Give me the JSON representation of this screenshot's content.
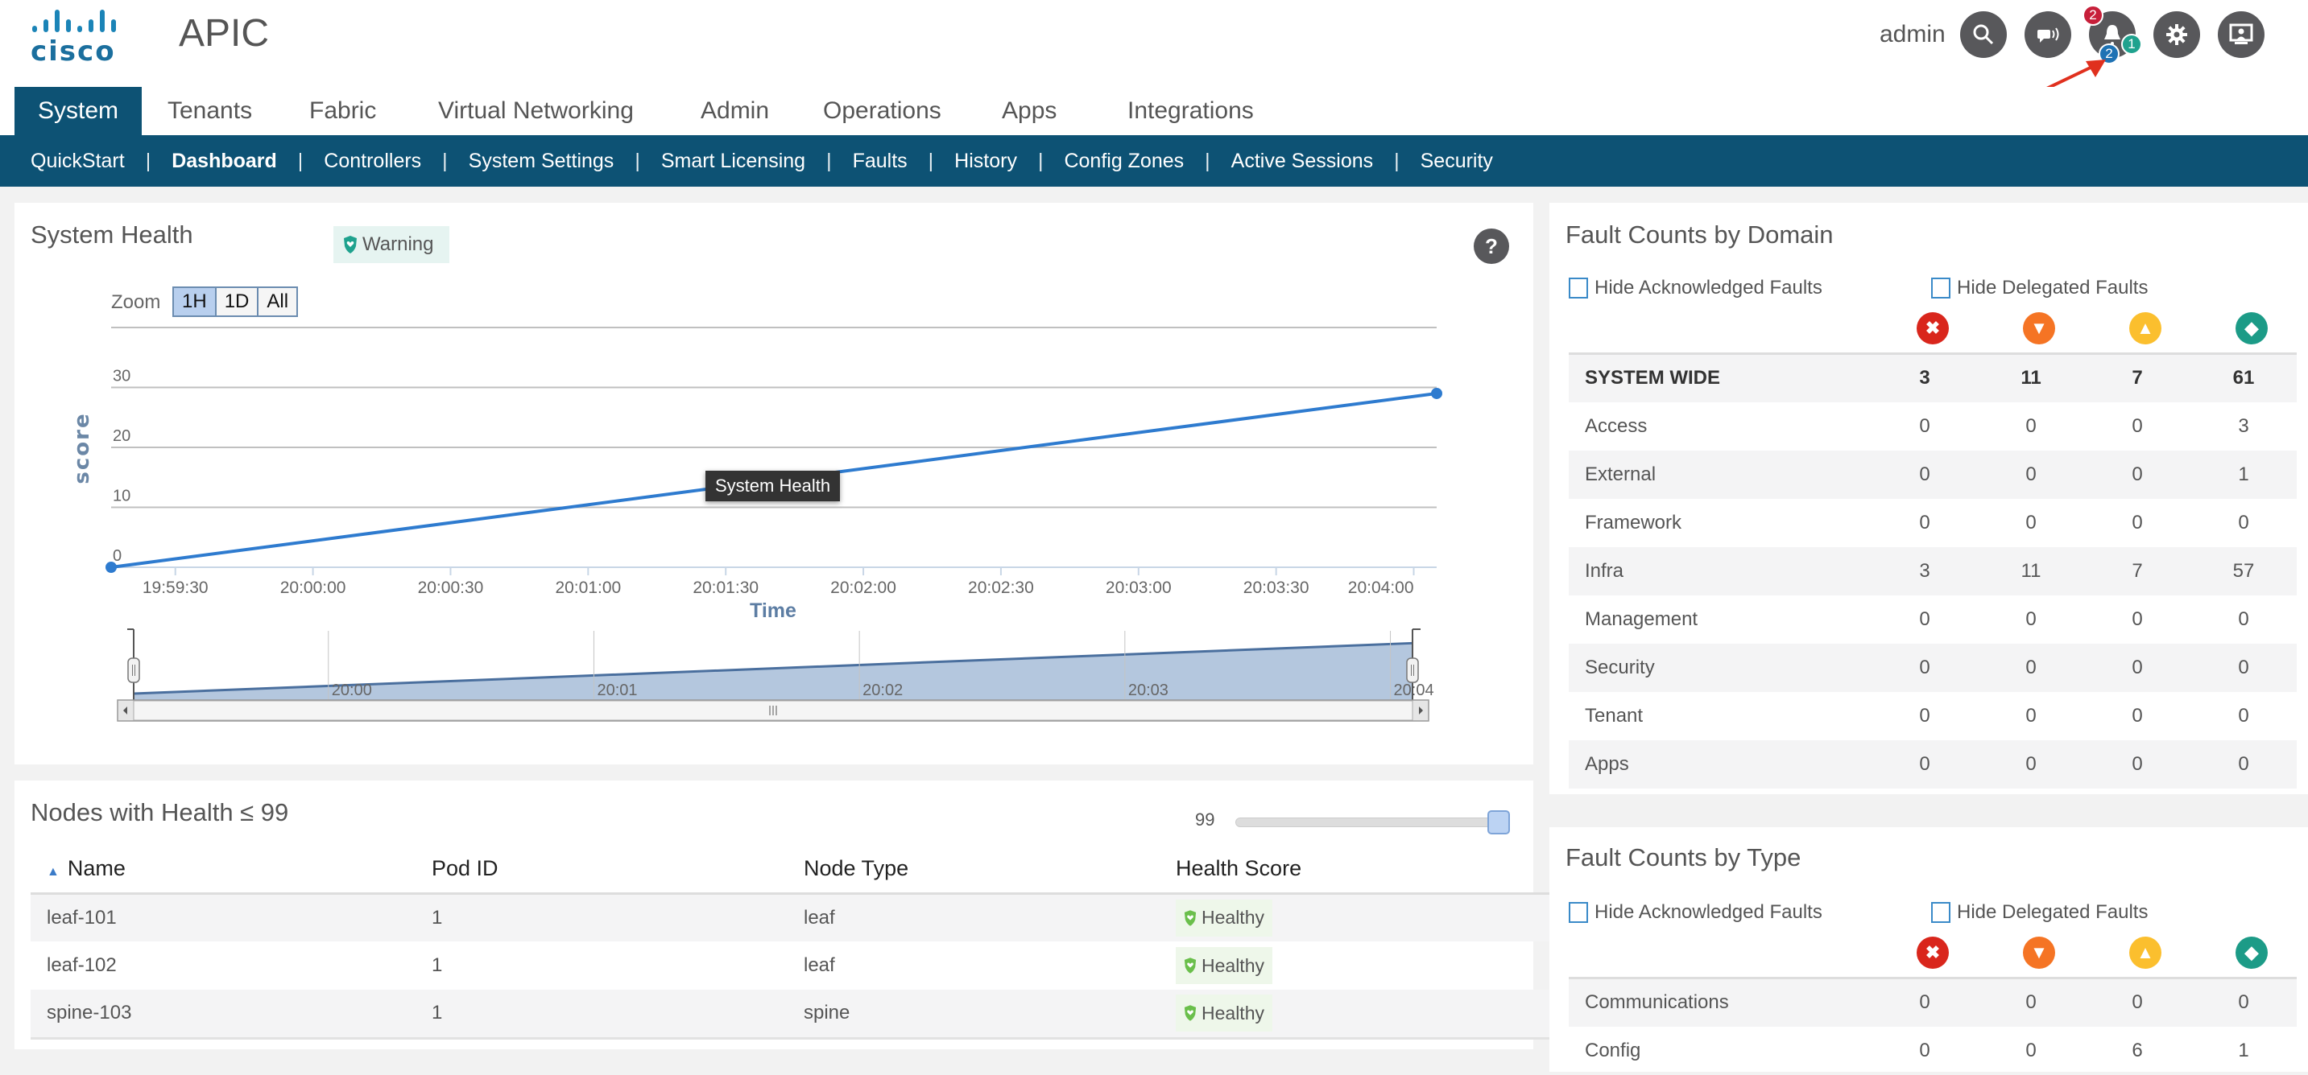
{
  "header": {
    "logo_text": "cisco",
    "app_title": "APIC",
    "user": "admin",
    "buttons": [
      {
        "name": "search-button",
        "icon": "search-icon"
      },
      {
        "name": "announcements-button",
        "icon": "megaphone-icon"
      },
      {
        "name": "alerts-button",
        "icon": "bell-icon",
        "badges": {
          "red": "2",
          "blue": "2",
          "teal": "1"
        }
      },
      {
        "name": "settings-button",
        "icon": "gear-icon"
      },
      {
        "name": "system-tools-button",
        "icon": "monitor-user-icon"
      }
    ]
  },
  "main_nav": {
    "tabs": [
      "System",
      "Tenants",
      "Fabric",
      "Virtual Networking",
      "Admin",
      "Operations",
      "Apps",
      "Integrations"
    ],
    "active": "System"
  },
  "sub_nav": {
    "items": [
      "QuickStart",
      "Dashboard",
      "Controllers",
      "System Settings",
      "Smart Licensing",
      "Faults",
      "History",
      "Config Zones",
      "Active Sessions",
      "Security"
    ],
    "active": "Dashboard"
  },
  "system_health": {
    "title": "System Health",
    "status": "Warning",
    "help": "?",
    "zoom_label": "Zoom",
    "zoom_options": [
      "1H",
      "1D",
      "All"
    ],
    "zoom_active": "1H",
    "tooltip": "System Health"
  },
  "chart_data": {
    "type": "line",
    "title": "System Health",
    "xlabel": "Time",
    "ylabel": "score",
    "x_ticks": [
      "19:59:30",
      "20:00:00",
      "20:00:30",
      "20:01:00",
      "20:01:30",
      "20:02:00",
      "20:02:30",
      "20:03:00",
      "20:03:30",
      "20:04:00"
    ],
    "y_ticks": [
      0,
      10,
      20,
      30
    ],
    "ylim": [
      0,
      40
    ],
    "grid": true,
    "series": [
      {
        "name": "System Health",
        "x": [
          "19:59:16",
          "20:04:05"
        ],
        "y": [
          0,
          29
        ],
        "color": "#2e7bcf"
      }
    ],
    "navigator": {
      "ticks": [
        "20:00",
        "20:01",
        "20:02",
        "20:03",
        "20:04"
      ]
    }
  },
  "nodes": {
    "title": "Nodes with Health ≤ 99",
    "slider_value": "99",
    "slider_fraction": 1.0,
    "columns": [
      "Name",
      "Pod ID",
      "Node Type",
      "Health Score"
    ],
    "rows": [
      {
        "name": "leaf-101",
        "pod": "1",
        "type": "leaf",
        "health": "Healthy"
      },
      {
        "name": "leaf-102",
        "pod": "1",
        "type": "leaf",
        "health": "Healthy"
      },
      {
        "name": "spine-103",
        "pod": "1",
        "type": "spine",
        "health": "Healthy"
      }
    ]
  },
  "fault_domain": {
    "title": "Fault Counts by Domain",
    "hide_ack": "Hide Acknowledged Faults",
    "hide_delegated": "Hide Delegated Faults",
    "severity_icons": [
      "critical-icon",
      "major-icon",
      "minor-icon",
      "warning-icon"
    ],
    "rows": [
      {
        "label": "SYSTEM WIDE",
        "values": [
          "3",
          "11",
          "7",
          "61"
        ],
        "bold": true
      },
      {
        "label": "Access",
        "values": [
          "0",
          "0",
          "0",
          "3"
        ]
      },
      {
        "label": "External",
        "values": [
          "0",
          "0",
          "0",
          "1"
        ]
      },
      {
        "label": "Framework",
        "values": [
          "0",
          "0",
          "0",
          "0"
        ]
      },
      {
        "label": "Infra",
        "values": [
          "3",
          "11",
          "7",
          "57"
        ]
      },
      {
        "label": "Management",
        "values": [
          "0",
          "0",
          "0",
          "0"
        ]
      },
      {
        "label": "Security",
        "values": [
          "0",
          "0",
          "0",
          "0"
        ]
      },
      {
        "label": "Tenant",
        "values": [
          "0",
          "0",
          "0",
          "0"
        ]
      },
      {
        "label": "Apps",
        "values": [
          "0",
          "0",
          "0",
          "0"
        ]
      }
    ]
  },
  "fault_type": {
    "title": "Fault Counts by Type",
    "hide_ack": "Hide Acknowledged Faults",
    "hide_delegated": "Hide Delegated Faults",
    "rows": [
      {
        "label": "Communications",
        "values": [
          "0",
          "0",
          "0",
          "0"
        ]
      },
      {
        "label": "Config",
        "values": [
          "0",
          "0",
          "6",
          "1"
        ]
      }
    ]
  },
  "colors": {
    "brand": "#0d5274",
    "critical": "#d9261c",
    "major": "#f57424",
    "minor": "#fbbf2e",
    "warning": "#1c9b87",
    "healthy": "#6abf4b",
    "series": "#2e7bcf"
  }
}
